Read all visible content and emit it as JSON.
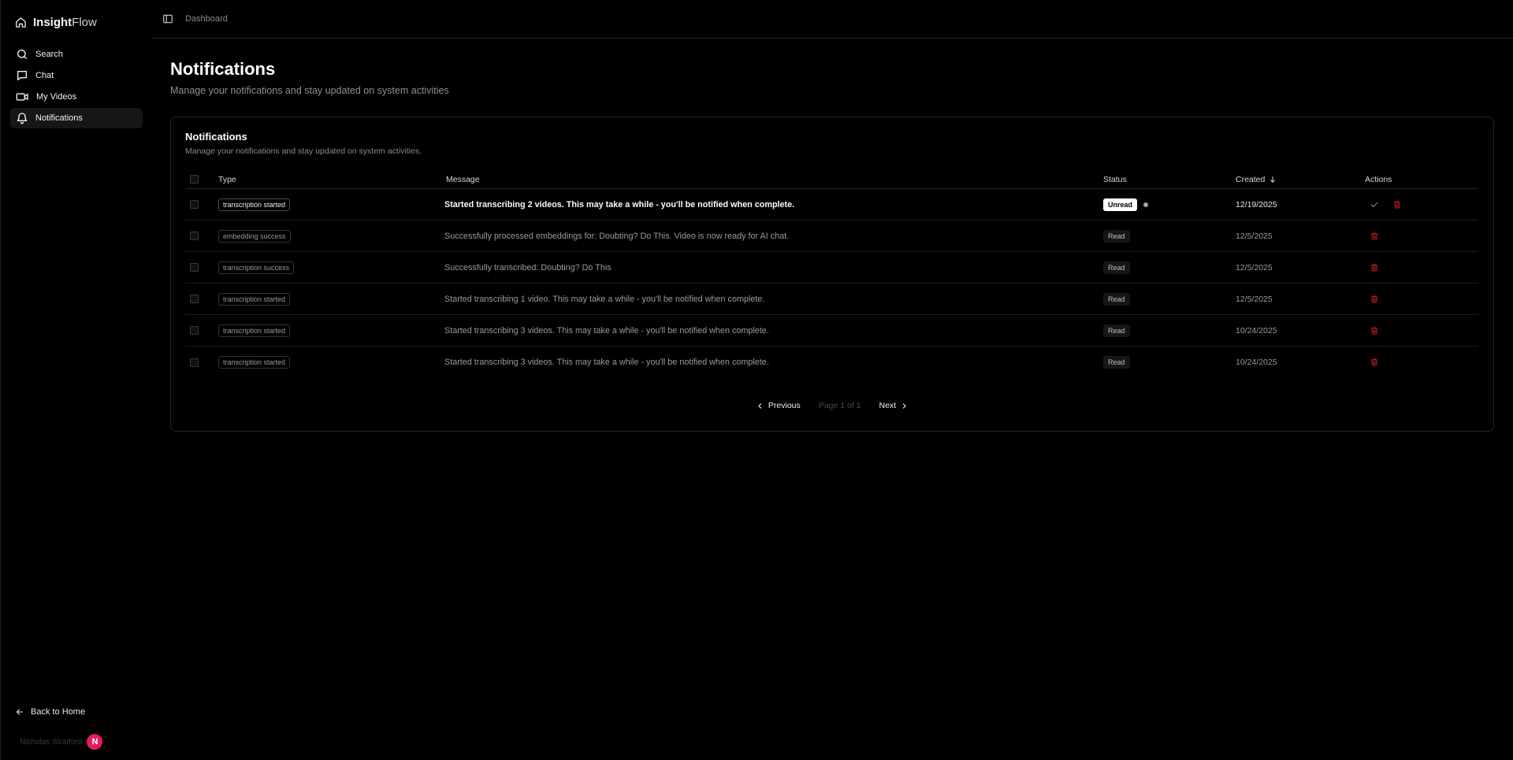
{
  "app": {
    "name_bold": "Insight",
    "name_light": "Flow"
  },
  "sidebar": {
    "items": [
      {
        "label": "Search",
        "icon": "search-icon"
      },
      {
        "label": "Chat",
        "icon": "chat-icon"
      },
      {
        "label": "My Videos",
        "icon": "video-icon"
      },
      {
        "label": "Notifications",
        "icon": "bell-icon",
        "active": true
      }
    ],
    "back_home": "Back to Home",
    "user_name": "Nicholas Stratford",
    "user_initial": "N",
    "avatar_color": "#e11d63"
  },
  "topbar": {
    "breadcrumb": "Dashboard"
  },
  "page": {
    "title": "Notifications",
    "subtitle": "Manage your notifications and stay updated on system activities"
  },
  "card": {
    "title": "Notifications",
    "subtitle": "Manage your notifications and stay updated on system activities."
  },
  "table": {
    "headers": {
      "type": "Type",
      "message": "Message",
      "status": "Status",
      "created": "Created",
      "actions": "Actions"
    },
    "rows": [
      {
        "type": "transcription started",
        "message": "Started transcribing 2 videos. This may take a while - you'll be notified when complete.",
        "status": "Unread",
        "created": "12/19/2025"
      },
      {
        "type": "embedding success",
        "message": "Successfully processed embeddings for: Doubting? Do This. Video is now ready for AI chat.",
        "status": "Read",
        "created": "12/5/2025"
      },
      {
        "type": "transcription success",
        "message": "Successfully transcribed: Doubting? Do This",
        "status": "Read",
        "created": "12/5/2025"
      },
      {
        "type": "transcription started",
        "message": "Started transcribing 1 video. This may take a while - you'll be notified when complete.",
        "status": "Read",
        "created": "12/5/2025"
      },
      {
        "type": "transcription started",
        "message": "Started transcribing 3 videos. This may take a while - you'll be notified when complete.",
        "status": "Read",
        "created": "10/24/2025"
      },
      {
        "type": "transcription started",
        "message": "Started transcribing 3 videos. This may take a while - you'll be notified when complete.",
        "status": "Read",
        "created": "10/24/2025"
      }
    ]
  },
  "pagination": {
    "previous": "Previous",
    "info": "Page 1 of 1",
    "next": "Next"
  },
  "colors": {
    "delete_red": "#b91c1c",
    "background": "#000000"
  }
}
